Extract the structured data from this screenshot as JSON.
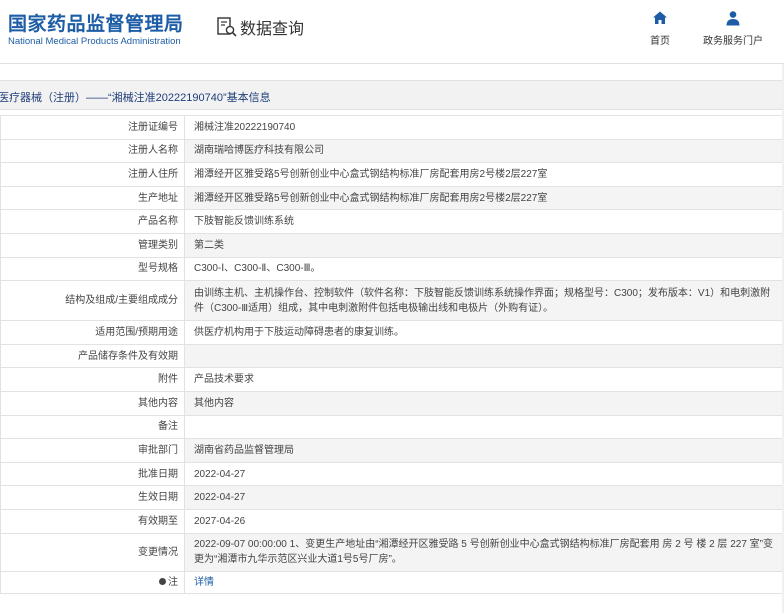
{
  "header": {
    "logo_cn": "国家药品监督管理局",
    "logo_en": "National Medical Products Administration",
    "query_label": "数据查询",
    "nav": [
      {
        "label": "首页",
        "icon": "home-icon"
      },
      {
        "label": "政务服务门户",
        "icon": "user-icon"
      }
    ]
  },
  "title_bar": {
    "text": "医疗器械（注册）——“湘械注准20222190740”基本信息"
  },
  "rows": [
    {
      "key": "注册证编号",
      "value": "湘械注准20222190740"
    },
    {
      "key": "注册人名称",
      "value": "湖南瑞哈博医疗科技有限公司"
    },
    {
      "key": "注册人住所",
      "value": "湘潭经开区雅受路5号创新创业中心盒式钢结构标准厂房配套用房2号楼2层227室"
    },
    {
      "key": "生产地址",
      "value": "湘潭经开区雅受路5号创新创业中心盒式钢结构标准厂房配套用房2号楼2层227室"
    },
    {
      "key": "产品名称",
      "value": "下肢智能反馈训练系统"
    },
    {
      "key": "管理类别",
      "value": "第二类"
    },
    {
      "key": "型号规格",
      "value": "C300-Ⅰ、C300-Ⅱ、C300-Ⅲ。"
    },
    {
      "key": "结构及组成/主要组成成分",
      "value": "由训练主机、主机操作台、控制软件（软件名称：下肢智能反馈训练系统操作界面；规格型号：C300；发布版本：V1）和电刺激附件（C300-Ⅲ适用）组成，其中电刺激附件包括电极输出线和电极片（外购有证）。"
    },
    {
      "key": "适用范围/预期用途",
      "value": "供医疗机构用于下肢运动障碍患者的康复训练。"
    },
    {
      "key": "产品储存条件及有效期",
      "value": ""
    },
    {
      "key": "附件",
      "value": "产品技术要求"
    },
    {
      "key": "其他内容",
      "value": "其他内容"
    },
    {
      "key": "备注",
      "value": ""
    },
    {
      "key": "审批部门",
      "value": "湖南省药品监督管理局"
    },
    {
      "key": "批准日期",
      "value": "2022-04-27"
    },
    {
      "key": "生效日期",
      "value": "2022-04-27"
    },
    {
      "key": "有效期至",
      "value": "2027-04-26"
    },
    {
      "key": "变更情况",
      "value": "2022-09-07 00:00:00 1、变更生产地址由“湘潭经开区雅受路 5 号创新创业中心盒式钢结构标准厂房配套用 房 2 号 楼 2 层 227 室”变更为“湘潭市九华示范区兴业大道1号5号厂房”。"
    },
    {
      "key": "注",
      "value": "详情"
    }
  ]
}
